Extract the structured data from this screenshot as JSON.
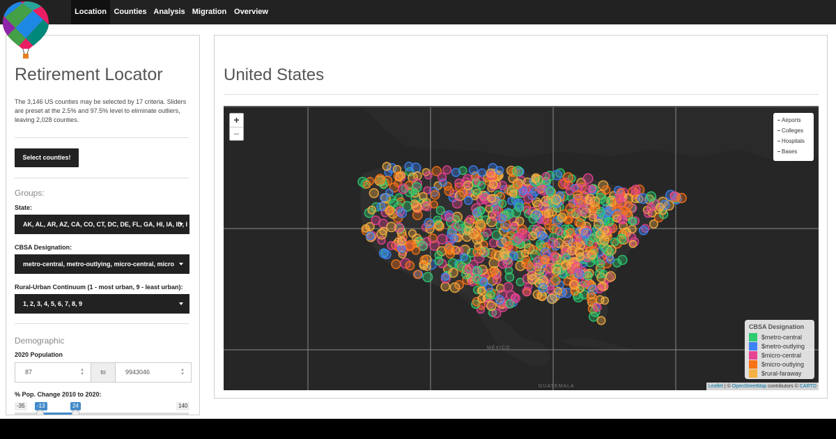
{
  "nav": {
    "tabs": [
      {
        "label": "Location",
        "active": true
      },
      {
        "label": "Counties"
      },
      {
        "label": "Analysis"
      },
      {
        "label": "Migration"
      },
      {
        "label": "Overview"
      }
    ]
  },
  "sidebar": {
    "title": "Retirement Locator",
    "description": "The 3,146 US counties may be selected by 17 criteria. Sliders are preset at the 2.5% and 97.5% level to eliminate outliers, leaving 2,028 counties.",
    "select_button": "Select counties!",
    "groups_heading": "Groups:",
    "state_label": "State:",
    "state_value": "AK, AL, AR, AZ, CA, CO, CT, DC, DE, FL, GA, HI, IA, ID, I",
    "cbsa_label": "CBSA Designation:",
    "cbsa_value": "metro-central, metro-outlying, micro-central, micro",
    "rural_label": "Rural-Urban Continuum (1 - most urban, 9 - least urban):",
    "rural_value": "1, 2, 3, 4, 5, 6, 7, 8, 9",
    "demographic_heading": "Demographic",
    "population_label": "2020 Population",
    "population_min": "87",
    "population_to": "to",
    "population_max": "9943046",
    "pop_change_label": "% Pop. Change 2010 to 2020:",
    "pop_change_slider": {
      "min": "-35",
      "low": "-13",
      "high": "24",
      "max": "140"
    }
  },
  "main": {
    "title": "United States",
    "zoom_in": "+",
    "zoom_out": "−",
    "layers": [
      "Airports",
      "Colleges",
      "Hospitals",
      "Bases"
    ],
    "legend_title": "CBSA Designation",
    "legend_items": [
      {
        "label": "$metro-central",
        "color": "#2ecc71"
      },
      {
        "label": "$metro-outlying",
        "color": "#3b82f6"
      },
      {
        "label": "$micro-central",
        "color": "#e84393"
      },
      {
        "label": "$micro-outlying",
        "color": "#f97316"
      },
      {
        "label": "$rural-faraway",
        "color": "#f5b041"
      }
    ],
    "attribution": {
      "leaflet": "Leaflet",
      "sep": " | © ",
      "osm": "OpenStreetMap",
      "mid": " contributors © ",
      "carto": "CARTO"
    },
    "map_labels": {
      "mexico": "MÉXICO",
      "guatemala": "GUATEMALA"
    }
  }
}
